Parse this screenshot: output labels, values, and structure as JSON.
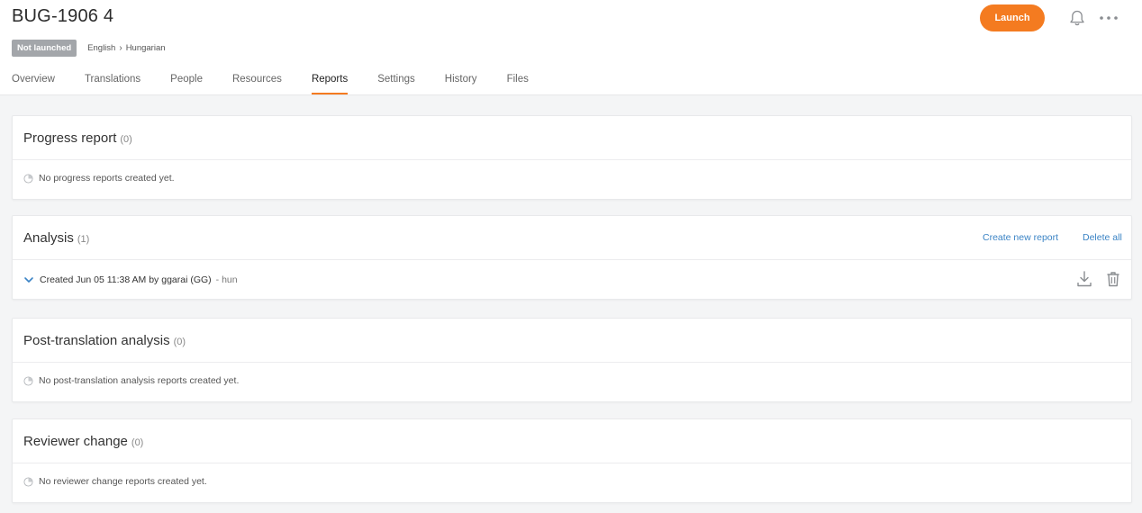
{
  "header": {
    "title": "BUG-1906 4",
    "status": "Not launched",
    "source_lang": "English",
    "target_lang": "Hungarian",
    "launch_label": "Launch",
    "accent_color": "#f47b20"
  },
  "icons": {
    "notifications": "bell-icon",
    "menu": "more-dots-icon",
    "empty": "report-icon",
    "expand": "chevron-down-icon",
    "download": "download-icon",
    "delete": "trash-icon"
  },
  "tabs": [
    {
      "label": "Overview",
      "active": false
    },
    {
      "label": "Translations",
      "active": false
    },
    {
      "label": "People",
      "active": false
    },
    {
      "label": "Resources",
      "active": false
    },
    {
      "label": "Reports",
      "active": true
    },
    {
      "label": "Settings",
      "active": false
    },
    {
      "label": "History",
      "active": false
    },
    {
      "label": "Files",
      "active": false
    }
  ],
  "sections": {
    "progress": {
      "title": "Progress report",
      "count": "(0)",
      "empty": "No progress reports created yet."
    },
    "analysis": {
      "title": "Analysis",
      "count": "(1)",
      "create_label": "Create new report",
      "delete_all_label": "Delete all",
      "report": {
        "created": "Created Jun 05 11:38 AM by ggarai (GG)",
        "lang": "- hun"
      }
    },
    "post_translation": {
      "title": "Post-translation analysis",
      "count": "(0)",
      "empty": "No post-translation analysis reports created yet."
    },
    "reviewer_change": {
      "title": "Reviewer change",
      "count": "(0)",
      "empty": "No reviewer change reports created yet."
    }
  }
}
